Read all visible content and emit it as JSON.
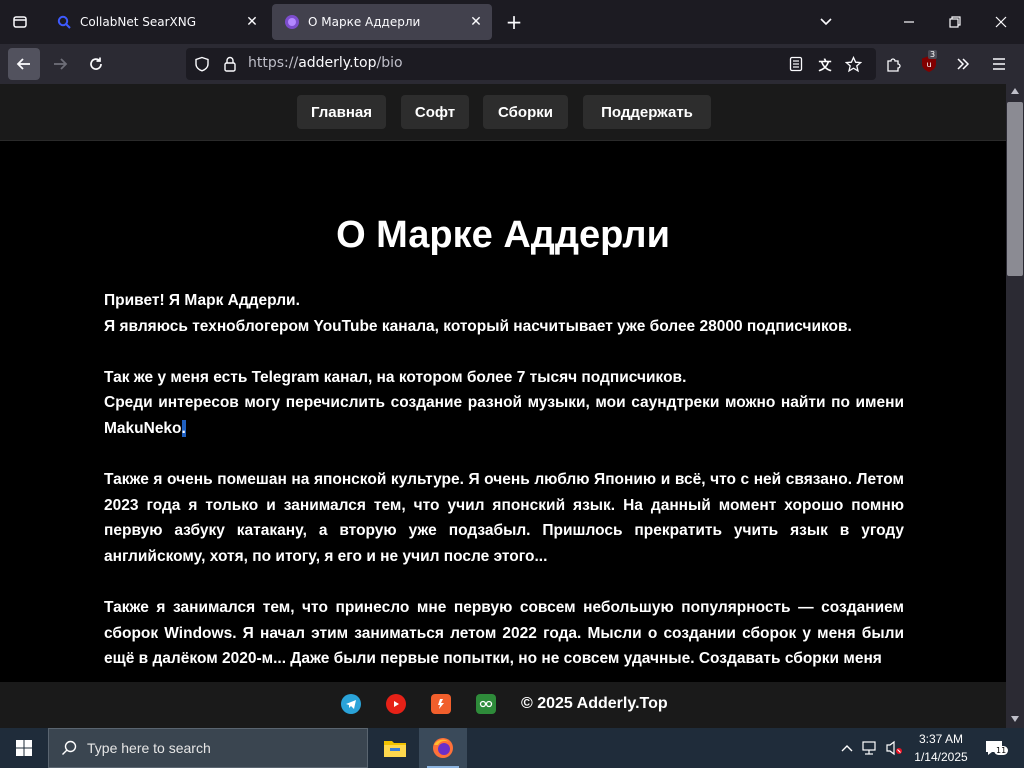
{
  "browser": {
    "tabs": [
      {
        "title": "CollabNet SearXNG",
        "active": false
      },
      {
        "title": "О Марке Аддерли",
        "active": true
      }
    ],
    "url_prefix": "https://",
    "url_host": "adderly.top",
    "url_path": "/bio",
    "extension_badge": "3"
  },
  "site": {
    "nav": [
      "Главная",
      "Софт",
      "Сборки",
      "Поддержать"
    ],
    "page_title": "О Марке Аддерли",
    "paragraphs": [
      {
        "lines": [
          "Привет! Я Марк Аддерли.",
          "Я являюсь техноблогером YouTube канала, который насчитывает уже более 28000 подписчиков."
        ]
      },
      {
        "lines": [
          "Так же у меня есть Telegram канал, на котором более 7 тысяч подписчиков.",
          "Среди интересов могу перечислить создание разной музыки, мои саундтреки можно найти по имени MakuNeko"
        ],
        "selected_suffix": "."
      },
      {
        "text": "Также я очень помешан на японской культуре. Я очень люблю Японию и всё, что с ней связано. Летом 2023 года я только и занимался тем, что учил японский язык. На данный момент хорошо помню первую азбуку катакану, а вторую уже подзабыл. Пришлось прекратить учить язык в угоду английскому, хотя, по итогу, я его и не учил после этого..."
      },
      {
        "text": "Также я занимался тем, что принесло мне первую совсем небольшую популярность — созданием сборок Windows. Я начал этим заниматься летом 2022 года. Мысли о создании сборок у меня были ещё в далёком 2020-м... Даже были первые попытки, но не совсем удачные. Создавать сборки меня"
      }
    ],
    "footer": {
      "icons": [
        "telegram-icon",
        "youtube-icon",
        "boosty-icon",
        "vk-video-icon"
      ],
      "copyright": "© 2025 Adderly.Top"
    }
  },
  "taskbar": {
    "search_placeholder": "Type here to search",
    "time": "3:37 AM",
    "date": "1/14/2025",
    "notification_count": "11"
  }
}
